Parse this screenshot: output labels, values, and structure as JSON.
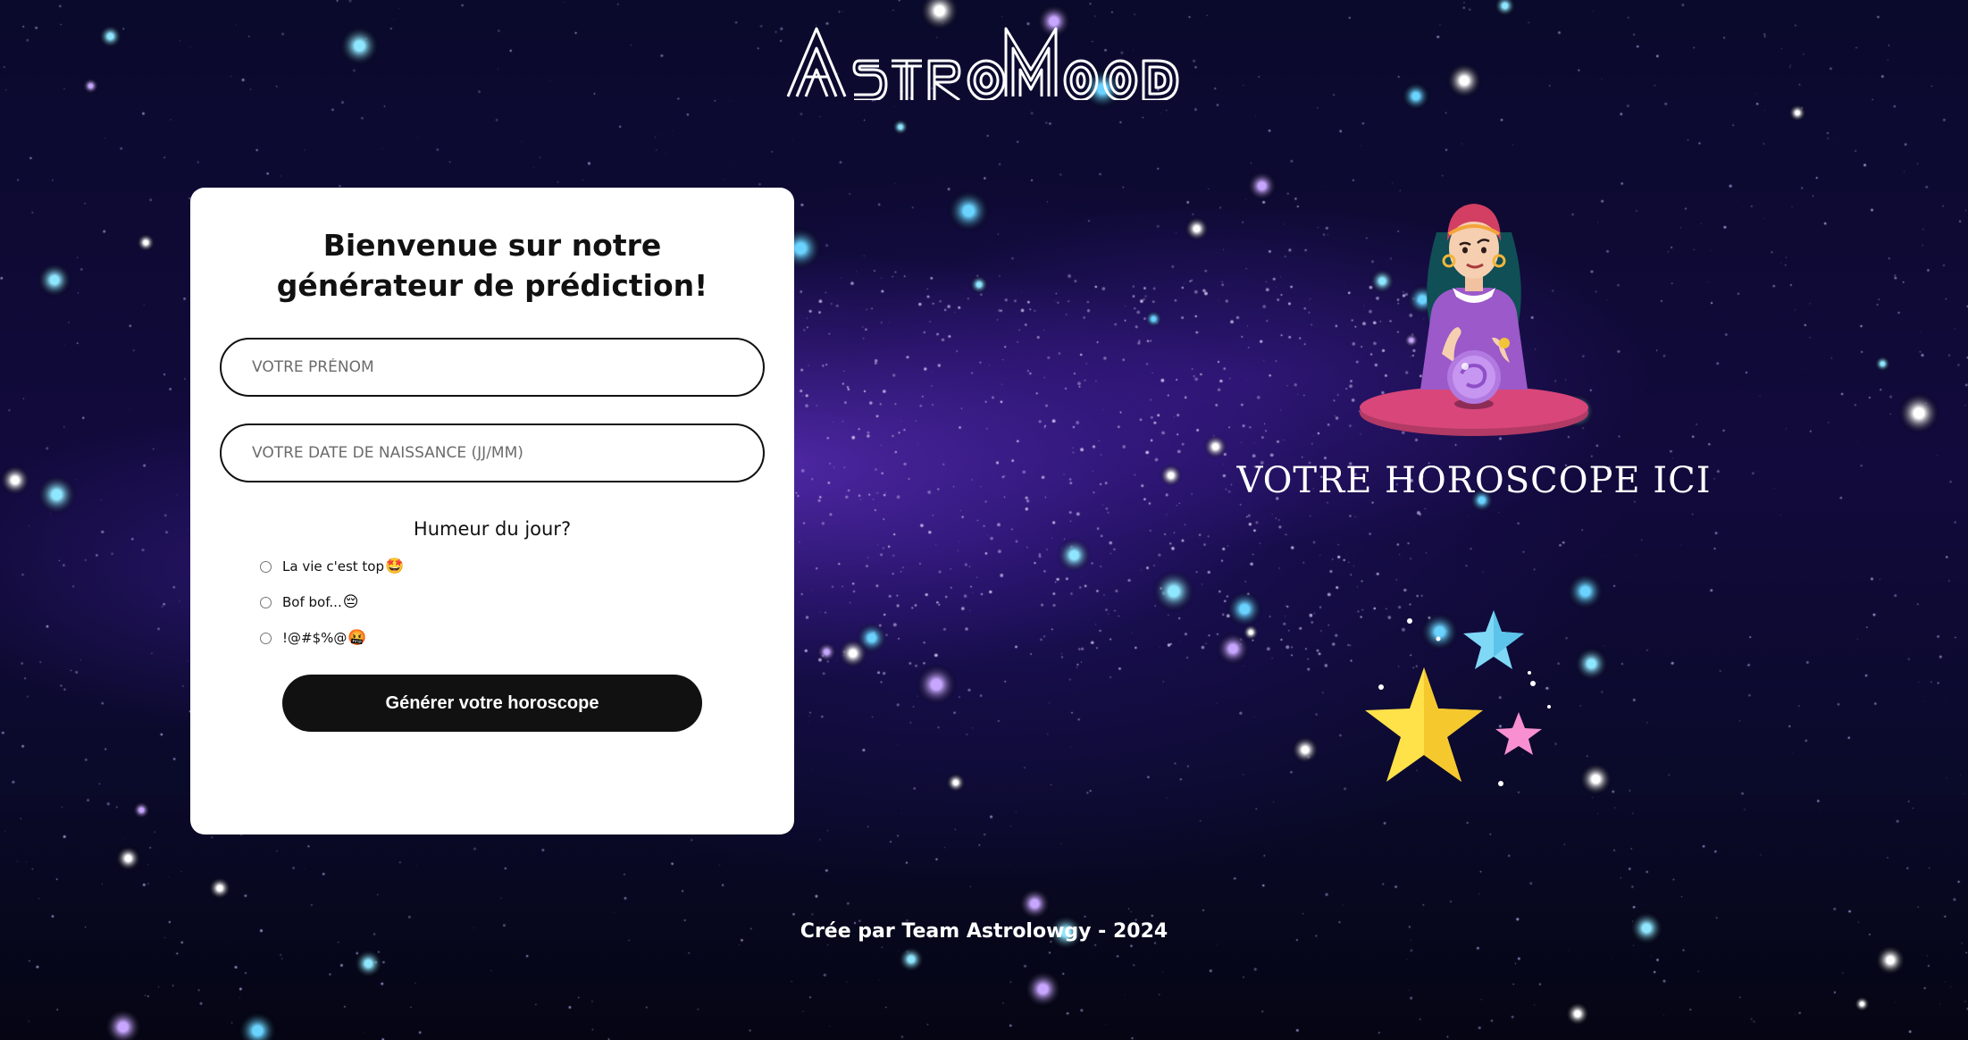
{
  "header": {
    "logo_text": "AstroMood"
  },
  "form": {
    "title": "Bienvenue sur notre générateur de prédiction!",
    "first_name_placeholder": "VOTRE PRÉNOM",
    "first_name_value": "",
    "birthdate_placeholder": "VOTRE DATE DE NAISSANCE (JJ/MM)",
    "birthdate_value": "",
    "mood_question": "Humeur du jour?",
    "mood_options": [
      {
        "label": "La vie c'est top",
        "emoji": "🤩",
        "selected": false
      },
      {
        "label": "Bof bof...",
        "emoji": "😔",
        "selected": false
      },
      {
        "label": "!@#$%@",
        "emoji": "🤬",
        "selected": false
      }
    ],
    "submit_label": "Générer votre horoscope"
  },
  "result": {
    "placeholder_text": "Votre horoscope ici"
  },
  "footer": {
    "credit": "Crée par Team Astrolowgy - 2024"
  },
  "colors": {
    "background_dark": "#0a0a2c",
    "nebula_purple": "#7a3ce6",
    "card_background": "#ffffff",
    "button_background": "#111111",
    "text_light": "#ffffff",
    "star_yellow": "#ffe14a",
    "star_blue": "#7fd8f6",
    "star_pink": "#f78fd0"
  }
}
